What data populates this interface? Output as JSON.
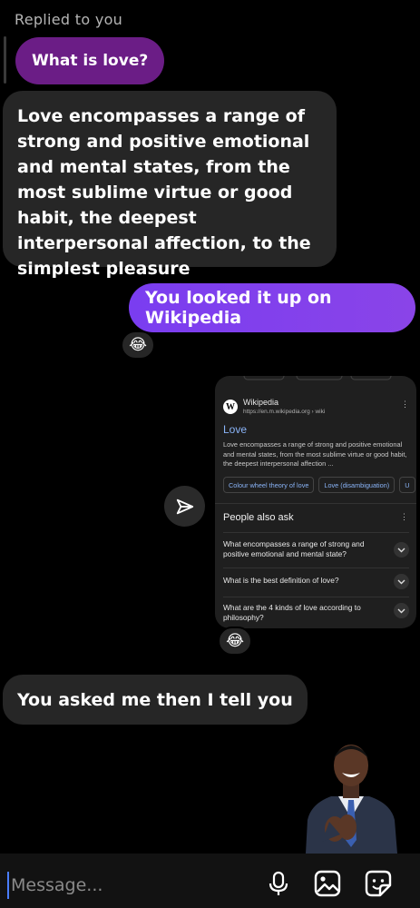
{
  "reply_header": "Replied to you",
  "quoted_message": "What is love?",
  "messages": {
    "incoming_1": "Love encompasses a range of strong and positive emotional and mental states, from the most sublime virtue or good habit, the deepest interpersonal affection, to the simplest pleasure",
    "outgoing_1": "You looked it up on Wikipedia",
    "incoming_2": "You asked me then I tell you"
  },
  "reactions": {
    "r1": "😂",
    "r2": "😂"
  },
  "shared_card": {
    "source_logo": "W",
    "source_name": "Wikipedia",
    "source_url": "https://en.m.wikipedia.org › wiki",
    "kebab": "⋮",
    "title": "Love",
    "snippet": "Love encompasses a range of strong and positive emotional and mental states, from the most sublime virtue or good habit, the deepest interpersonal affection ...",
    "chips": [
      "Colour wheel theory of love",
      "Love (disambiguation)",
      "U"
    ],
    "people_also_ask": "People also ask",
    "questions": [
      "What encompasses a range of strong and positive emotional and mental state?",
      "What is the best definition of love?",
      "What are the 4 kinds of love according to philosophy?"
    ]
  },
  "composer": {
    "placeholder": "Message..."
  },
  "colors": {
    "outgoing": "#7a3df0",
    "quoted": "#6b1d86",
    "incoming": "#262626",
    "link": "#8ab4f8"
  }
}
